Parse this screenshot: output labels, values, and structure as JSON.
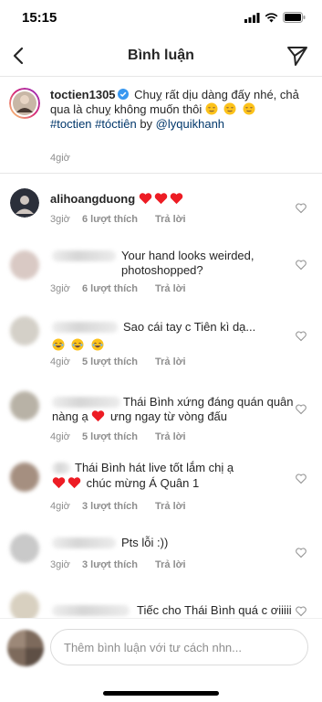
{
  "status_bar": {
    "time": "15:15"
  },
  "header": {
    "title": "Bình luận"
  },
  "caption": {
    "username": "toctien1305",
    "text": "Chuỵ rất dịu dàng đấy nhé, chả qua là chuỵ không muốn thôi",
    "hashtags": "#toctien #tóctiên",
    "by_text": "by",
    "mention": "@lyquikhanh",
    "time": "4giờ"
  },
  "comments": [
    {
      "username": "alihoangduong",
      "text": "",
      "time": "3giờ",
      "likes": "6 lượt thích",
      "reply": "Trả lời"
    },
    {
      "username": "",
      "text": "Your hand looks weirded, photoshopped?",
      "time": "3giờ",
      "likes": "6 lượt thích",
      "reply": "Trả lời"
    },
    {
      "username": "",
      "text": "Sao cái tay c Tiên kì dạ...",
      "time": "4giờ",
      "likes": "5 lượt thích",
      "reply": "Trả lời"
    },
    {
      "username": "",
      "text_a": "Thái Bình xứng đáng quán quân nàng ạ",
      "text_b": "ưng ngay từ vòng đấu",
      "time": "4giờ",
      "likes": "5 lượt thích",
      "reply": "Trả lời"
    },
    {
      "username": "",
      "text_a": "Thái Bình hát live tốt lắm chị ạ",
      "text_b": "chúc mừng Á Quân 1",
      "time": "4giờ",
      "likes": "3 lượt thích",
      "reply": "Trả lời"
    },
    {
      "username": "",
      "text": "Pts lỗi :))",
      "time": "3giờ",
      "likes": "3 lượt thích",
      "reply": "Trả lời"
    },
    {
      "username": "",
      "text": "Tiếc cho Thái Bình quá c ơiiiii"
    }
  ],
  "input": {
    "placeholder": "Thêm bình luận với tư cách nhn..."
  },
  "colors": {
    "text": "#262626",
    "secondary": "#8e8e8e",
    "link": "#00376b",
    "heart": "#ed1c24",
    "verified": "#3897f0"
  }
}
